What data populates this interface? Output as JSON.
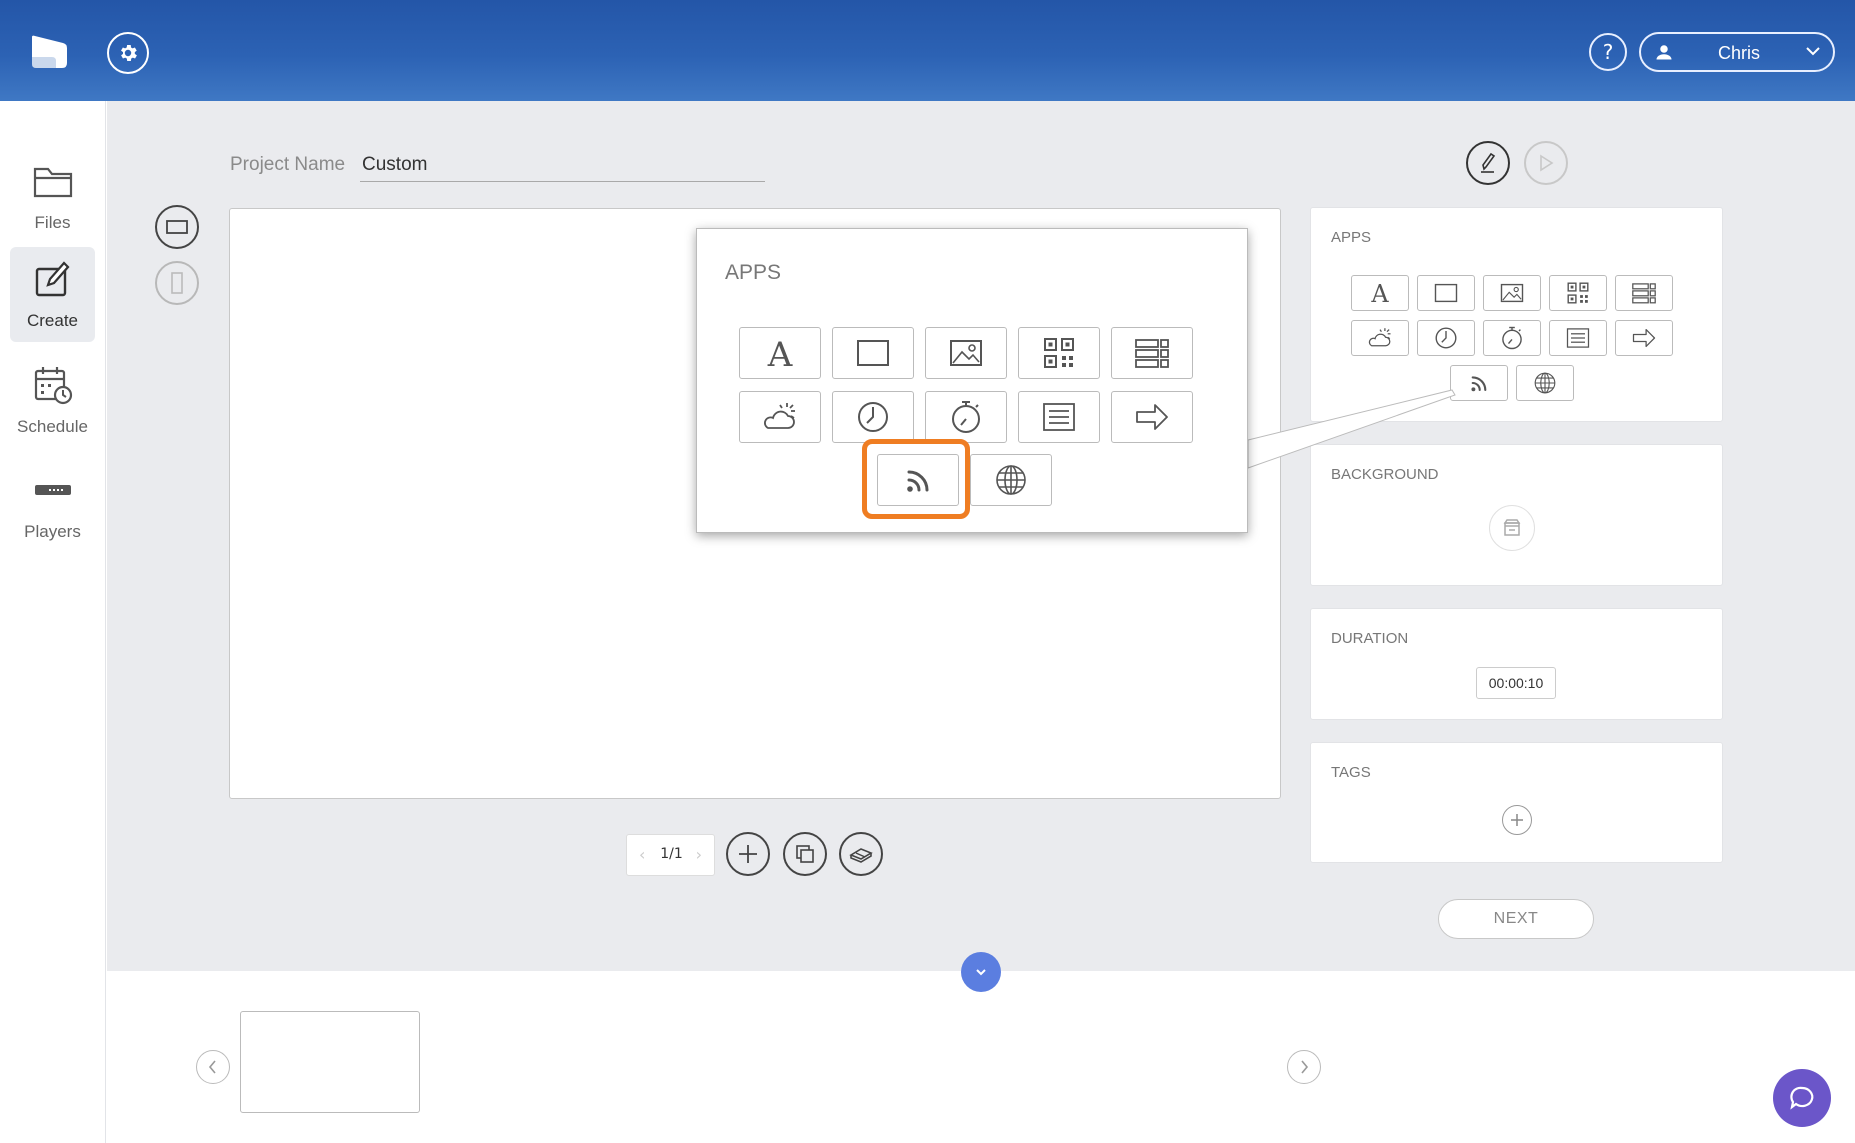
{
  "header": {
    "user_name": "Chris",
    "help_label": "?"
  },
  "sidebar": {
    "items": [
      {
        "label": "Files",
        "icon": "folder-icon"
      },
      {
        "label": "Create",
        "icon": "create-icon",
        "active": true
      },
      {
        "label": "Schedule",
        "icon": "schedule-icon"
      },
      {
        "label": "Players",
        "icon": "player-icon"
      }
    ]
  },
  "project": {
    "label": "Project Name",
    "value": "Custom"
  },
  "pager": {
    "value": "1/1"
  },
  "panels": {
    "apps_title": "APPS",
    "background_title": "BACKGROUND",
    "duration_title": "DURATION",
    "duration_value": "00:00:10",
    "tags_title": "TAGS"
  },
  "next_label": "NEXT",
  "callout": {
    "title": "APPS",
    "highlighted_app": "rss-icon"
  },
  "apps": [
    "text-icon",
    "shape-icon",
    "image-icon",
    "qr-icon",
    "list-icon",
    "weather-icon",
    "clock-icon",
    "timer-icon",
    "ticker-icon",
    "arrow-icon",
    "rss-icon",
    "web-icon"
  ],
  "colors": {
    "header": "#2c62b4",
    "highlight": "#ef7d22",
    "chat": "#6b56c9",
    "collapse": "#5b7ee0"
  }
}
